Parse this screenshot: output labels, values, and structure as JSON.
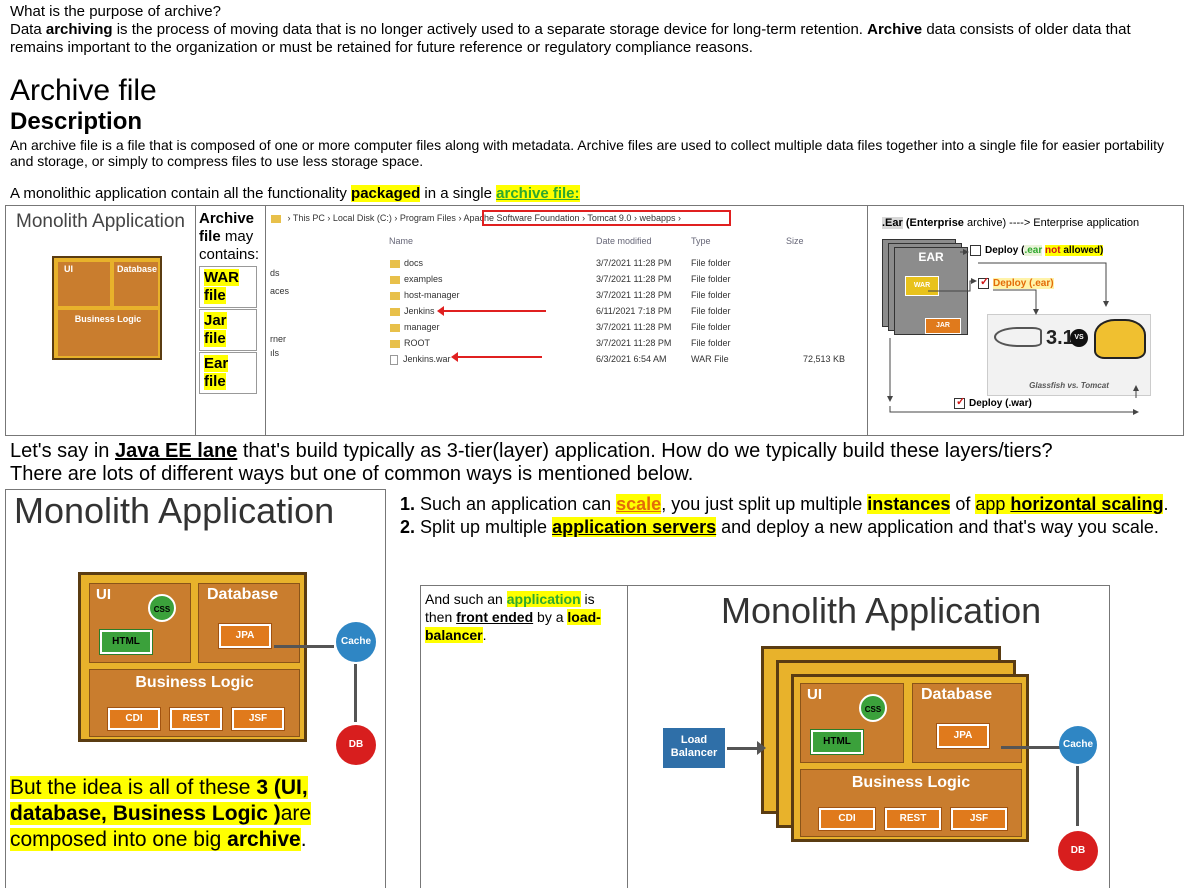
{
  "intro": {
    "question": "What is the purpose of archive?",
    "p1_a": "Data ",
    "p1_b": "archiving",
    "p1_c": " is the process of moving data that is no longer actively used to a separate storage device for long-term retention. ",
    "p1_d": "Archive",
    "p1_e": " data consists of older data that remains important to the organization or must be retained for future reference or regulatory compliance reasons."
  },
  "archive_file": {
    "heading": "Archive file",
    "subheading": "Description",
    "text": "An archive file is a file that is composed of one or more computer files along with metadata. Archive files are used to collect multiple data files together into a single file for easier portability and storage, or simply to compress files to use less storage space.",
    "mono_a": "A monolithic application contain all the functionality ",
    "mono_b": "packaged",
    "mono_c": " in a single ",
    "mono_d": "archive file:"
  },
  "table1": {
    "mini_title": "Monolith Application",
    "mini_ui": "UI",
    "mini_db": "Database",
    "mini_bl": "Business Logic",
    "contains_a": "Archive",
    "contains_b": " file",
    "contains_c": " may contains:",
    "war": "WAR file",
    "jar": "Jar file",
    "ear": "Ear file",
    "explorer": {
      "crumbs": [
        "This PC",
        "Local Disk (C:)",
        "Program Files",
        "Apache Software Foundation",
        "Tomcat 9.0",
        "webapps"
      ],
      "col_name": "Name",
      "col_date": "Date modified",
      "col_type": "Type",
      "col_size": "Size",
      "side": [
        "ds",
        "aces",
        "rner",
        "ıls"
      ],
      "rows": [
        {
          "name": "docs",
          "date": "3/7/2021 11:28 PM",
          "type": "File folder",
          "size": ""
        },
        {
          "name": "examples",
          "date": "3/7/2021 11:28 PM",
          "type": "File folder",
          "size": ""
        },
        {
          "name": "host-manager",
          "date": "3/7/2021 11:28 PM",
          "type": "File folder",
          "size": ""
        },
        {
          "name": "Jenkins",
          "date": "6/11/2021 7:18 PM",
          "type": "File folder",
          "size": ""
        },
        {
          "name": "manager",
          "date": "3/7/2021 11:28 PM",
          "type": "File folder",
          "size": ""
        },
        {
          "name": "ROOT",
          "date": "3/7/2021 11:28 PM",
          "type": "File folder",
          "size": ""
        },
        {
          "name": "Jenkins.war",
          "date": "6/3/2021 6:54 AM",
          "type": "WAR File",
          "size": "72,513 KB"
        }
      ]
    },
    "ear_diagram": {
      "title_a": ".Ear",
      "title_b": " (Enterprise ",
      "title_c": "archive) ----> Enterprise application",
      "ear_label": "EAR",
      "war_label": "WAR",
      "jar_label": "JAR",
      "deploy1_a": "Deploy (",
      "deploy1_b": ".ear",
      "deploy1_c": " ",
      "deploy1_d": "not",
      "deploy1_e": " allowed)",
      "deploy2": "Deploy (.ear)",
      "deploy3": "Deploy (.war)",
      "glassfish_caption": "Glassfish vs. Tomcat",
      "vs": "VS",
      "gf_version": "3.1"
    }
  },
  "middle": {
    "line1_a": "Let's say in ",
    "line1_b": "Java EE lane",
    "line1_c": " that's build typically as 3-tier(layer) application. How do we typically build these layers/tiers?",
    "line2": "There are lots of different ways but one of common ways is mentioned below."
  },
  "diagram": {
    "title": "Monolith Application",
    "ui": "UI",
    "css": "CSS",
    "html": "HTML",
    "database": "Database",
    "jpa": "JPA",
    "business_logic": "Business Logic",
    "cdi": "CDI",
    "rest": "REST",
    "jsf": "JSF",
    "cache": "Cache",
    "db": "DB",
    "load_balancer": "Load Balancer"
  },
  "note": {
    "a": "But the idea is all of these ",
    "b": "3 (UI, database, Business Logic )",
    "c": "are composed into one big ",
    "d": "archive",
    "e": "."
  },
  "list": {
    "item1_a": "Such an application can ",
    "item1_b": "scale",
    "item1_c": ", you just split up multiple ",
    "item1_d": "instances",
    "item1_e": " of ",
    "item1_f": "app",
    "item1_g": " ",
    "item1_h": "horizontal scaling",
    "item1_i": ".",
    "item2_a": "Split up multiple ",
    "item2_b": "application servers",
    "item2_c": " and deploy a new application and that's way you scale."
  },
  "table3": {
    "a": "And such an ",
    "b": "application",
    "c": " is then ",
    "d": "front ended",
    "e": " by a ",
    "f": "load-balancer",
    "g": "."
  },
  "colors": {
    "highlight": "#ffff00",
    "box_yellow": "#e8b22b",
    "box_brown": "#c97d2e",
    "green": "#3ba13b",
    "orange": "#e07a1c",
    "cache_blue": "#2f86c4",
    "db_red": "#d81e1e",
    "lb_blue": "#2f6fa8"
  }
}
